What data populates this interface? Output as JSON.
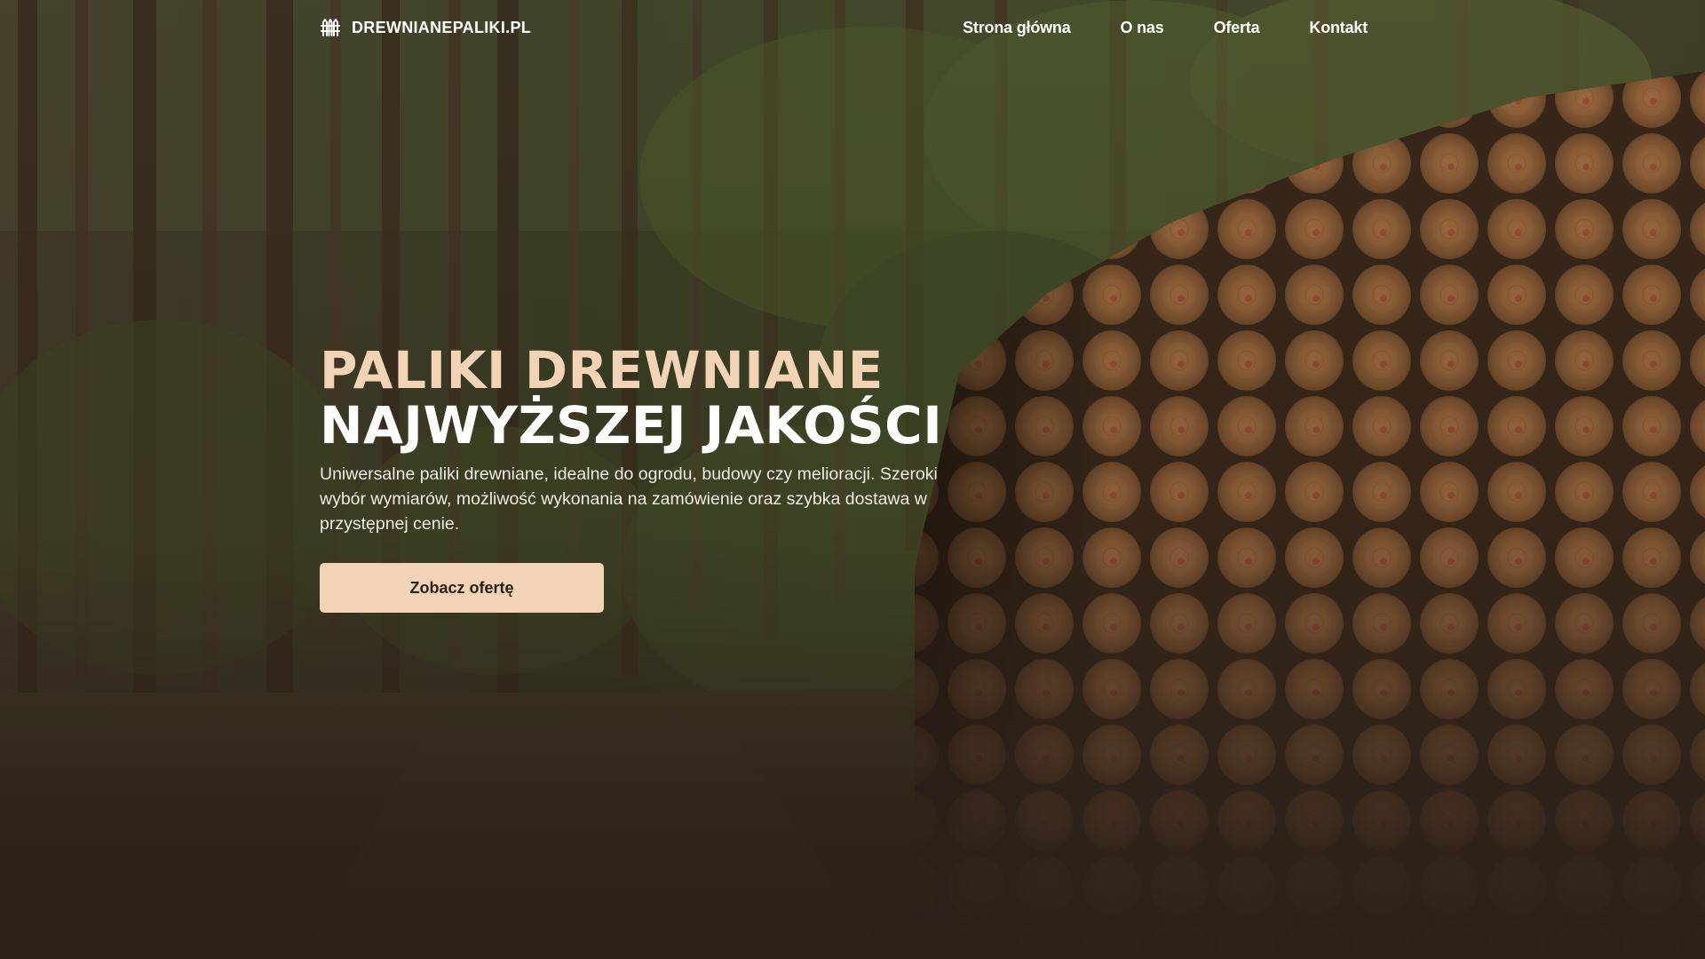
{
  "brand": {
    "name": "DREWNIANEPALIKI.PL",
    "icon": "fence-icon"
  },
  "nav": {
    "items": [
      {
        "label": "Strona główna"
      },
      {
        "label": "O nas"
      },
      {
        "label": "Oferta"
      },
      {
        "label": "Kontakt"
      }
    ]
  },
  "hero": {
    "title_line1": "PALIKI DREWNIANE",
    "title_line2": "NAJWYŻSZEJ JAKOŚCI",
    "description": "Uniwersalne paliki drewniane, idealne do ogrodu, budowy czy melioracji. Szeroki wybór wymiarów, możliwość wykonania na zamówienie oraz szybka dostawa w przystępnej cenie.",
    "cta_label": "Zobacz ofertę",
    "background": "forest-path-with-stacked-logs-photo"
  },
  "colors": {
    "accent": "#f3d3b5",
    "text": "#ffffff",
    "footer_bg": "#2d211a"
  }
}
